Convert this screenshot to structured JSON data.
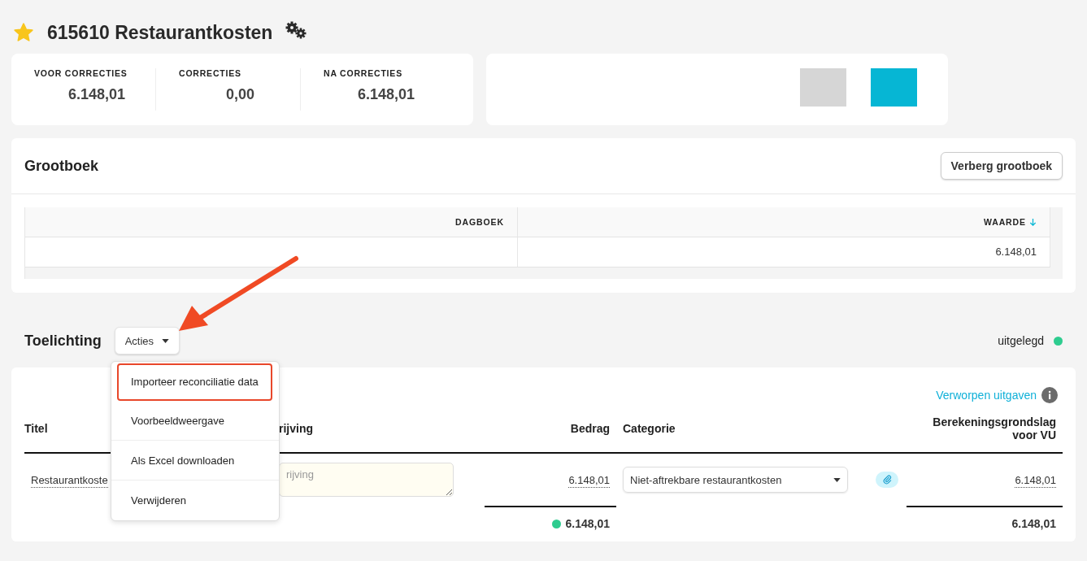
{
  "header": {
    "title": "615610 Restaurantkosten",
    "favorite": true
  },
  "summary": [
    {
      "label": "VOOR CORRECTIES",
      "value": "6.148,01"
    },
    {
      "label": "CORRECTIES",
      "value": "0,00"
    },
    {
      "label": "NA CORRECTIES",
      "value": "6.148,01"
    }
  ],
  "swatches": [
    {
      "color": "#d6d6d6"
    },
    {
      "color": "#06b6d4"
    }
  ],
  "ledger": {
    "title": "Grootboek",
    "hide_button": "Verberg grootboek",
    "columns": [
      {
        "label": "DAGBOEK",
        "sorted": false
      },
      {
        "label": "WAARDE",
        "sorted": true
      }
    ],
    "rows": [
      {
        "waarde": "6.148,01"
      }
    ]
  },
  "explanation": {
    "title": "Toelichting",
    "actions_button": "Acties",
    "status": "uitgelegd",
    "menu": [
      {
        "label": "Importeer reconciliatie data",
        "highlighted": true
      },
      {
        "label": "Voorbeeldweergave",
        "highlighted": false
      },
      {
        "label": "Als Excel downloaden",
        "highlighted": false
      },
      {
        "label": "Verwijderen",
        "highlighted": false
      }
    ],
    "link": "Verworpen uitgaven",
    "columns": [
      "Titel",
      "rijving",
      "Bedrag",
      "Categorie",
      "Berekeningsgrondslag voor VU"
    ],
    "rows": [
      {
        "title": "Restaurantkoste",
        "description_placeholder": "rijving",
        "amount": "6.148,01",
        "category": "Niet-aftrekbare restaurantkosten",
        "base": "6.148,01"
      }
    ],
    "totals": {
      "amount": "6.148,01",
      "base": "6.148,01"
    }
  }
}
